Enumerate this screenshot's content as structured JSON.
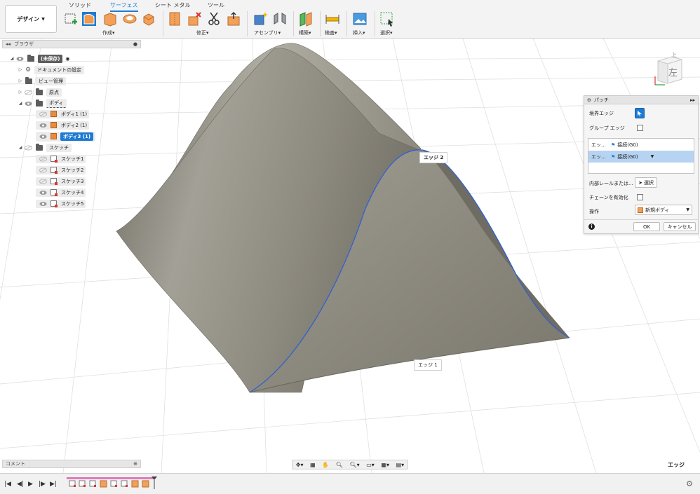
{
  "toolbar": {
    "workspace": "デザイン",
    "tabs": [
      "ソリッド",
      "サーフェス",
      "シート メタル",
      "ツール"
    ],
    "active_tab": "サーフェス",
    "groups": [
      "作成",
      "修正",
      "アセンブリ",
      "構築",
      "検査",
      "挿入",
      "選択"
    ],
    "dropdown_caret": "▾"
  },
  "browser": {
    "title": "ブラウザ",
    "root": "(未保存)",
    "items": [
      "ドキュメントの設定",
      "ビュー管理",
      "原点",
      "ボディ",
      "スケッチ"
    ],
    "bodies": [
      "ボディ1 (1)",
      "ボディ2 (1)",
      "ボディ3 (1)"
    ],
    "sketches": [
      "スケッチ1",
      "スケッチ2",
      "スケッチ3",
      "スケッチ4",
      "スケッチ5"
    ]
  },
  "viewcube": {
    "face": "左",
    "top_text": "上"
  },
  "viewport": {
    "edge_label_1": "エッジ 1",
    "edge_label_2": "エッジ 2"
  },
  "patch_dialog": {
    "title": "パッチ",
    "boundary_edge": "境界エッジ",
    "group_edge": "グループ エッジ",
    "edge_rows": [
      {
        "name": "エッ...",
        "continuity": "接続(G0)"
      },
      {
        "name": "エッ...",
        "continuity": "接続(G0)"
      }
    ],
    "interior_rails": "内部レールまたは...",
    "select_btn": "選択",
    "chain": "チェーンを有効化",
    "operation_label": "操作",
    "operation_value": "新規ボディ",
    "ok": "OK",
    "cancel": "キャンセル",
    "info": "i"
  },
  "comments": {
    "title": "コメント"
  },
  "status": {
    "selection": "エッジ"
  },
  "colors": {
    "accent": "#1e7bd4",
    "surface": "#8f8d83",
    "edge_highlight": "#2b5fd6"
  }
}
